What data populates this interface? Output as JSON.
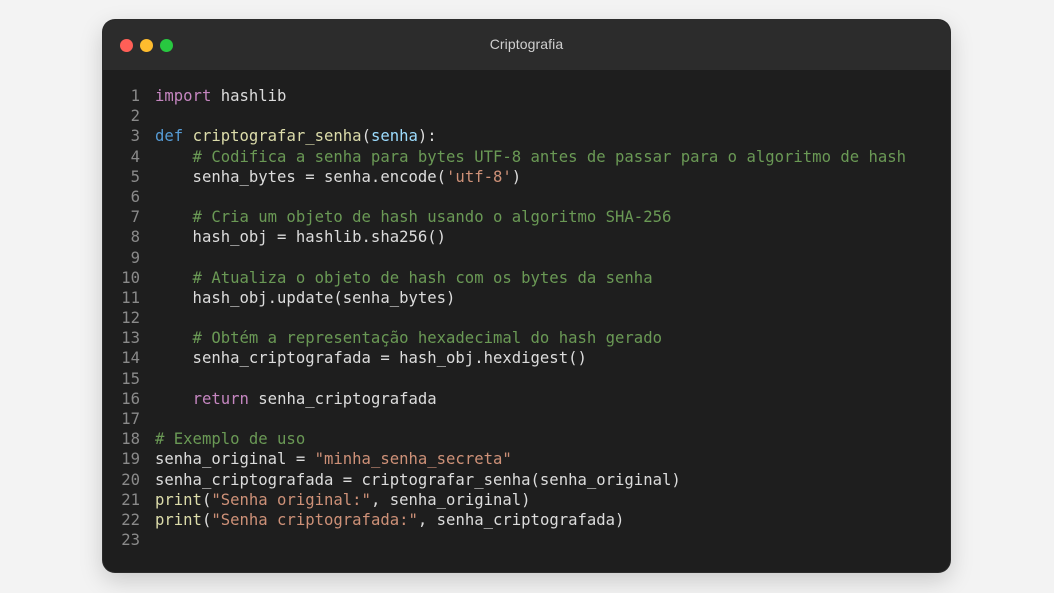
{
  "window": {
    "title": "Criptografia",
    "controls": [
      {
        "name": "close",
        "color": "#ff5f57"
      },
      {
        "name": "minimize",
        "color": "#febc2e"
      },
      {
        "name": "maximize",
        "color": "#28c840"
      }
    ]
  },
  "colors": {
    "keyword": "#c586c0",
    "def": "#569cd6",
    "function": "#dcdcaa",
    "parameter": "#9cdcfe",
    "string": "#ce9178",
    "comment": "#6a9955",
    "text": "#dcdcdc",
    "line_number": "#8a8a8a",
    "background": "#1e1e1e"
  },
  "code": {
    "lines": [
      {
        "n": "1",
        "tokens": [
          {
            "t": "import",
            "k": "kw"
          },
          {
            "t": " hashlib",
            "k": "plain"
          }
        ]
      },
      {
        "n": "2",
        "tokens": []
      },
      {
        "n": "3",
        "tokens": [
          {
            "t": "def",
            "k": "def"
          },
          {
            "t": " ",
            "k": "plain"
          },
          {
            "t": "criptografar_senha",
            "k": "fn"
          },
          {
            "t": "(",
            "k": "plain"
          },
          {
            "t": "senha",
            "k": "param"
          },
          {
            "t": "):",
            "k": "plain"
          }
        ]
      },
      {
        "n": "4",
        "tokens": [
          {
            "t": "    # Codifica a senha para bytes UTF-8 antes de passar para o algoritmo de hash",
            "k": "com"
          }
        ]
      },
      {
        "n": "5",
        "tokens": [
          {
            "t": "    senha_bytes = senha.encode(",
            "k": "plain"
          },
          {
            "t": "'utf-8'",
            "k": "str"
          },
          {
            "t": ")",
            "k": "plain"
          }
        ]
      },
      {
        "n": "6",
        "tokens": []
      },
      {
        "n": "7",
        "tokens": [
          {
            "t": "    # Cria um objeto de hash usando o algoritmo SHA-256",
            "k": "com"
          }
        ]
      },
      {
        "n": "8",
        "tokens": [
          {
            "t": "    hash_obj = hashlib.sha256()",
            "k": "plain"
          }
        ]
      },
      {
        "n": "9",
        "tokens": []
      },
      {
        "n": "10",
        "tokens": [
          {
            "t": "    # Atualiza o objeto de hash com os bytes da senha",
            "k": "com"
          }
        ]
      },
      {
        "n": "11",
        "tokens": [
          {
            "t": "    hash_obj.update(senha_bytes)",
            "k": "plain"
          }
        ]
      },
      {
        "n": "12",
        "tokens": []
      },
      {
        "n": "13",
        "tokens": [
          {
            "t": "    # Obtém a representação hexadecimal do hash gerado",
            "k": "com"
          }
        ]
      },
      {
        "n": "14",
        "tokens": [
          {
            "t": "    senha_criptografada = hash_obj.hexdigest()",
            "k": "plain"
          }
        ]
      },
      {
        "n": "15",
        "tokens": []
      },
      {
        "n": "16",
        "tokens": [
          {
            "t": "    ",
            "k": "plain"
          },
          {
            "t": "return",
            "k": "kw"
          },
          {
            "t": " senha_criptografada",
            "k": "plain"
          }
        ]
      },
      {
        "n": "17",
        "tokens": []
      },
      {
        "n": "18",
        "tokens": [
          {
            "t": "# Exemplo de uso",
            "k": "com"
          }
        ]
      },
      {
        "n": "19",
        "tokens": [
          {
            "t": "senha_original = ",
            "k": "plain"
          },
          {
            "t": "\"minha_senha_secreta\"",
            "k": "str"
          }
        ]
      },
      {
        "n": "20",
        "tokens": [
          {
            "t": "senha_criptografada = criptografar_senha(senha_original)",
            "k": "plain"
          }
        ]
      },
      {
        "n": "21",
        "tokens": [
          {
            "t": "print",
            "k": "fn"
          },
          {
            "t": "(",
            "k": "plain"
          },
          {
            "t": "\"Senha original:\"",
            "k": "str"
          },
          {
            "t": ", senha_original)",
            "k": "plain"
          }
        ]
      },
      {
        "n": "22",
        "tokens": [
          {
            "t": "print",
            "k": "fn"
          },
          {
            "t": "(",
            "k": "plain"
          },
          {
            "t": "\"Senha criptografada:\"",
            "k": "str"
          },
          {
            "t": ", senha_criptografada)",
            "k": "plain"
          }
        ]
      },
      {
        "n": "23",
        "tokens": []
      }
    ]
  }
}
